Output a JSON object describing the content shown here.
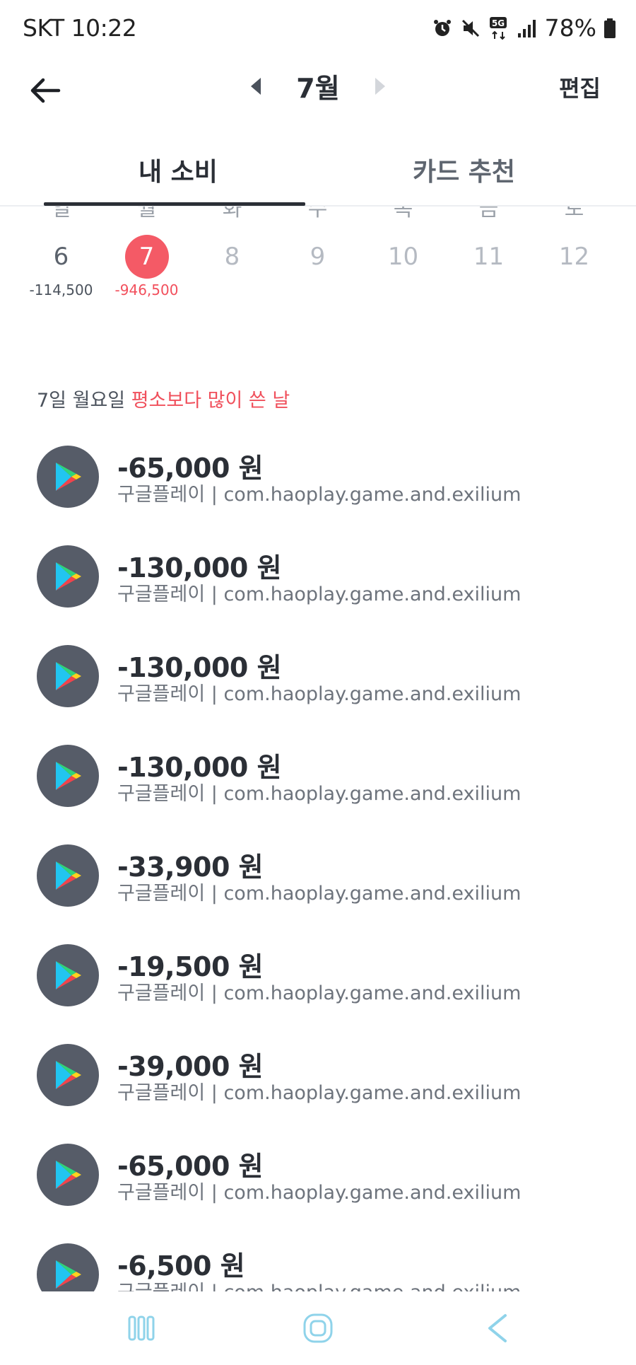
{
  "status_bar": {
    "carrier_time": "SKT 10:22",
    "network_badge": "5G",
    "battery": "78%",
    "icons": [
      "alarm-icon",
      "mute-icon",
      "5g-icon",
      "signal-icon",
      "battery-icon"
    ]
  },
  "header": {
    "month": "7월",
    "edit_label": "편집"
  },
  "tabs": [
    {
      "label": "내 소비",
      "active": true
    },
    {
      "label": "카드 추천",
      "active": false
    }
  ],
  "calendar": {
    "weekdays": [
      "일",
      "월",
      "화",
      "수",
      "목",
      "금",
      "토"
    ],
    "days": [
      {
        "num": "6",
        "amount": "-114,500",
        "state": "active"
      },
      {
        "num": "7",
        "amount": "-946,500",
        "state": "today"
      },
      {
        "num": "8",
        "amount": "",
        "state": "future"
      },
      {
        "num": "9",
        "amount": "",
        "state": "future"
      },
      {
        "num": "10",
        "amount": "",
        "state": "future"
      },
      {
        "num": "11",
        "amount": "",
        "state": "future"
      },
      {
        "num": "12",
        "amount": "",
        "state": "future"
      }
    ]
  },
  "summary": {
    "prefix": "7일 월요일",
    "highlight": "평소보다 많이 쓴 날"
  },
  "transactions": [
    {
      "amount": "-65,000 원",
      "detail": "구글플레이 | com.haoplay.game.and.exilium"
    },
    {
      "amount": "-130,000 원",
      "detail": "구글플레이 | com.haoplay.game.and.exilium"
    },
    {
      "amount": "-130,000 원",
      "detail": "구글플레이 | com.haoplay.game.and.exilium"
    },
    {
      "amount": "-130,000 원",
      "detail": "구글플레이 | com.haoplay.game.and.exilium"
    },
    {
      "amount": "-33,900 원",
      "detail": "구글플레이 | com.haoplay.game.and.exilium"
    },
    {
      "amount": "-19,500 원",
      "detail": "구글플레이 | com.haoplay.game.and.exilium"
    },
    {
      "amount": "-39,000 원",
      "detail": "구글플레이 | com.haoplay.game.and.exilium"
    },
    {
      "amount": "-65,000 원",
      "detail": "구글플레이 | com.haoplay.game.and.exilium"
    },
    {
      "amount": "-6,500 원",
      "detail": "구글플레이 | com.haoplay.game.and.exilium"
    }
  ],
  "colors": {
    "accent_red": "#f45a66",
    "text_dark": "#2b2f36",
    "icon_bg": "#565c68",
    "nav_blue": "#8fd3ea"
  }
}
